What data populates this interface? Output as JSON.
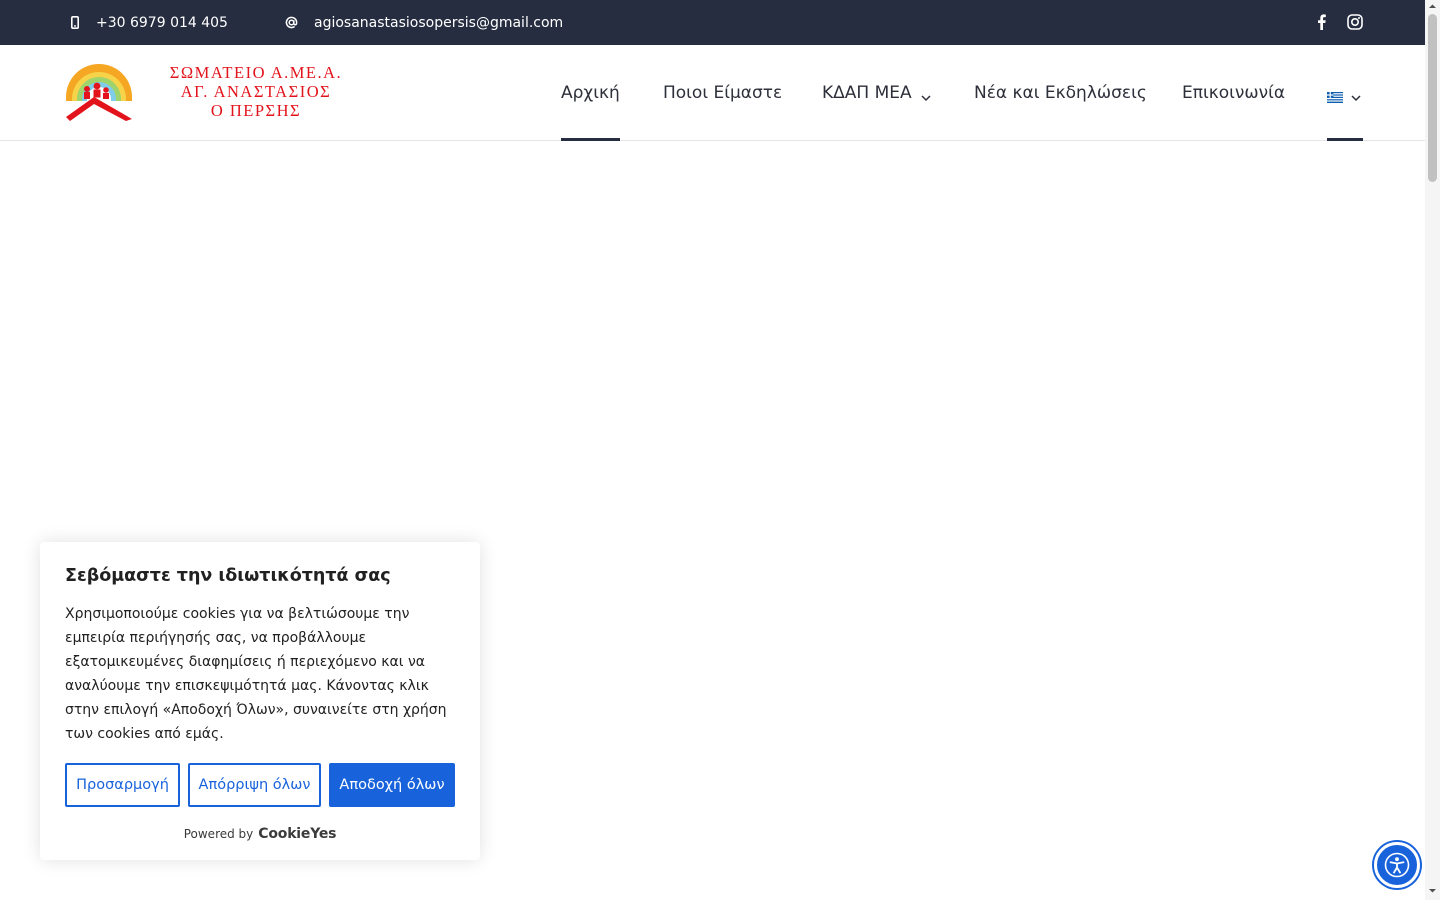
{
  "topbar": {
    "phone": "+30 6979 014 405",
    "email": "agiosanastasiosopersis@gmail.com",
    "icons": {
      "phone": "mobile-phone-icon",
      "email": "at-sign-icon",
      "facebook": "facebook-icon",
      "instagram": "instagram-icon"
    }
  },
  "logo": {
    "line1": "ΣΩΜΑΤΕΙΟ Α.ΜΕ.Α.",
    "line2": "ΑΓ. ΑΝΑΣΤΑΣΙΟΣ",
    "line3": "Ο ΠΕΡΣΗΣ"
  },
  "nav": {
    "items": [
      {
        "label": "Αρχική",
        "active": true
      },
      {
        "label": "Ποιοι Είμαστε"
      },
      {
        "label": "ΚΔΑΠ ΜΕΑ",
        "dropdown": true
      },
      {
        "label": "Νέα και Εκδηλώσεις"
      },
      {
        "label": "Επικοινωνία"
      }
    ],
    "language_icon": "greek-flag-icon"
  },
  "cookie": {
    "title": "Σεβόμαστε την ιδιωτικότητά σας",
    "description": "Χρησιμοποιούμε cookies για να βελτιώσουμε την εμπειρία περιήγησής σας, να προβάλλουμε εξατομικευμένες διαφημίσεις ή περιεχόμενο και να αναλύουμε την επισκεψιμότητά μας. Κάνοντας κλικ στην επιλογή «Αποδοχή Όλων», συναινείτε στη χρήση των cookies από εμάς.",
    "buttons": {
      "customize": "Προσαρμογή",
      "reject": "Απόρριψη όλων",
      "accept": "Αποδοχή όλων"
    },
    "powered_by": "Powered by",
    "brand": "CookieYes"
  },
  "colors": {
    "topbar_bg": "#262d40",
    "accent_blue": "#1863dc",
    "logo_red": "#e3131b"
  },
  "accessibility": {
    "icon": "accessibility-person-icon"
  }
}
